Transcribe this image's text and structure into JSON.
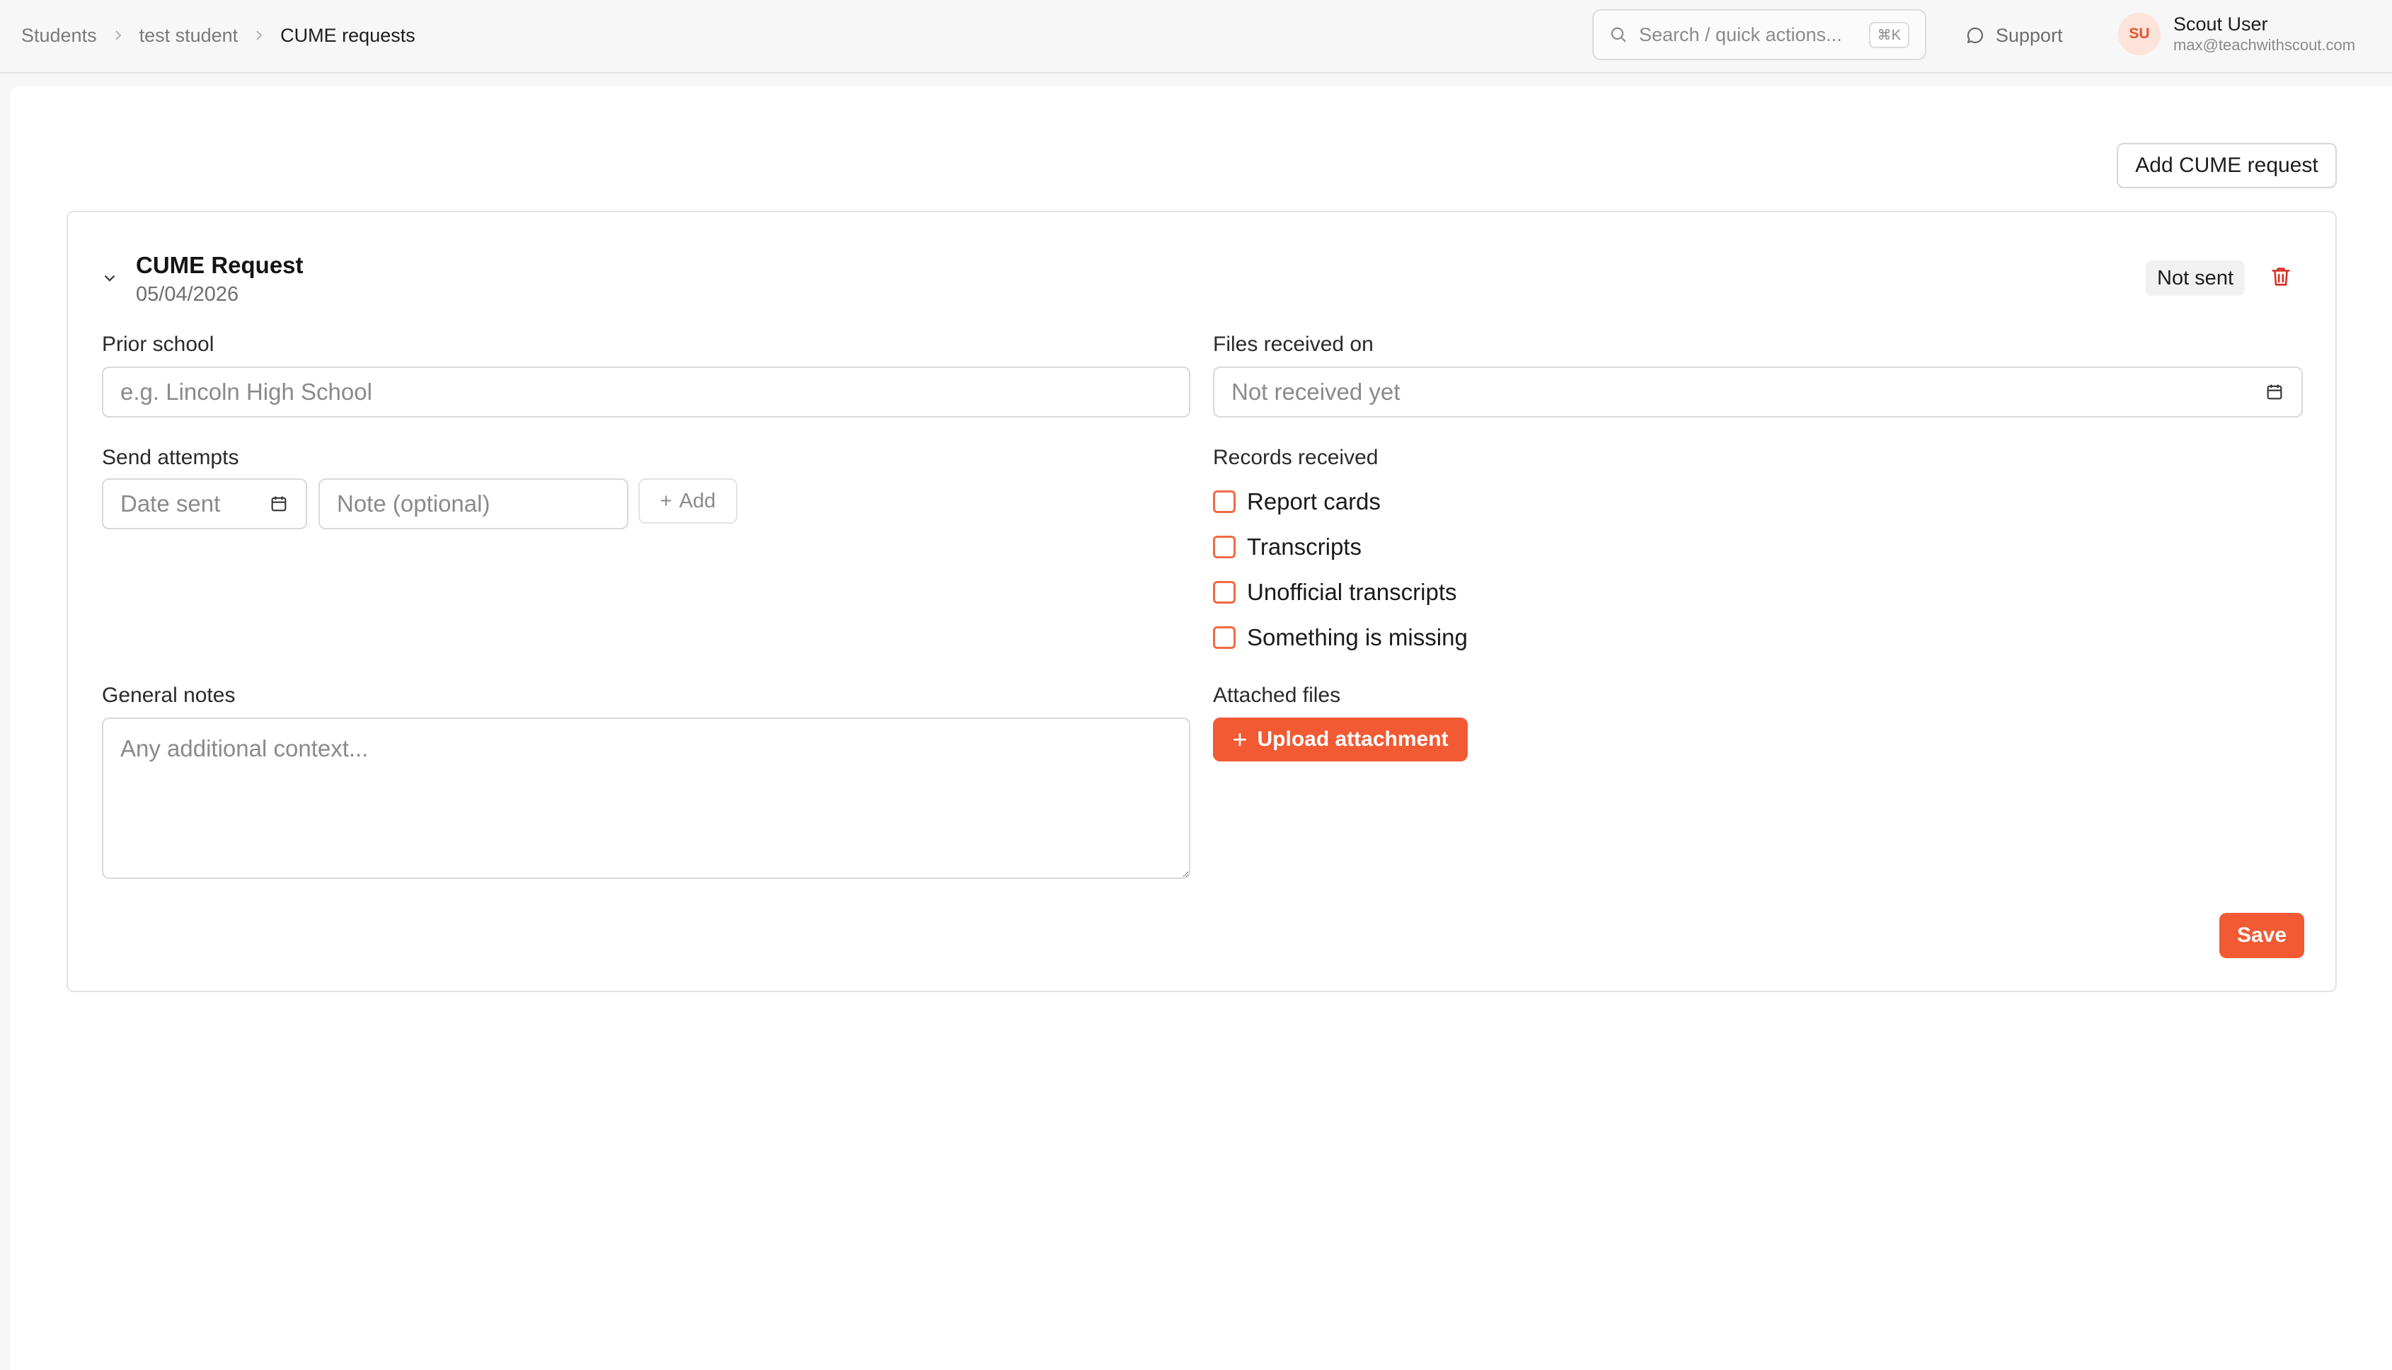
{
  "breadcrumb": {
    "items": [
      "Students",
      "test student",
      "CUME requests"
    ]
  },
  "header": {
    "search_placeholder": "Search / quick actions...",
    "search_shortcut": "⌘K",
    "support_label": "Support",
    "user": {
      "initials": "SU",
      "name": "Scout User",
      "email": "max@teachwithscout.com"
    }
  },
  "toolbar": {
    "add_label": "Add CUME request"
  },
  "request": {
    "title": "CUME Request",
    "date": "05/04/2026",
    "status": "Not sent",
    "prior_school": {
      "label": "Prior school",
      "placeholder": "e.g. Lincoln High School",
      "value": ""
    },
    "files_received": {
      "label": "Files received on",
      "placeholder": "Not received yet"
    },
    "send_attempts": {
      "label": "Send attempts",
      "date_placeholder": "Date sent",
      "note_placeholder": "Note (optional)",
      "add_label": "Add"
    },
    "records_received": {
      "label": "Records received",
      "options": [
        {
          "label": "Report cards",
          "checked": false
        },
        {
          "label": "Transcripts",
          "checked": false
        },
        {
          "label": "Unofficial transcripts",
          "checked": false
        },
        {
          "label": "Something is missing",
          "checked": false
        }
      ]
    },
    "general_notes": {
      "label": "General notes",
      "placeholder": "Any additional context..."
    },
    "attached_files": {
      "label": "Attached files",
      "upload_label": "Upload attachment"
    },
    "save_label": "Save"
  },
  "colors": {
    "accent": "#f15a33",
    "checkbox_border": "#f06a45",
    "delete_icon": "#d92d20"
  }
}
